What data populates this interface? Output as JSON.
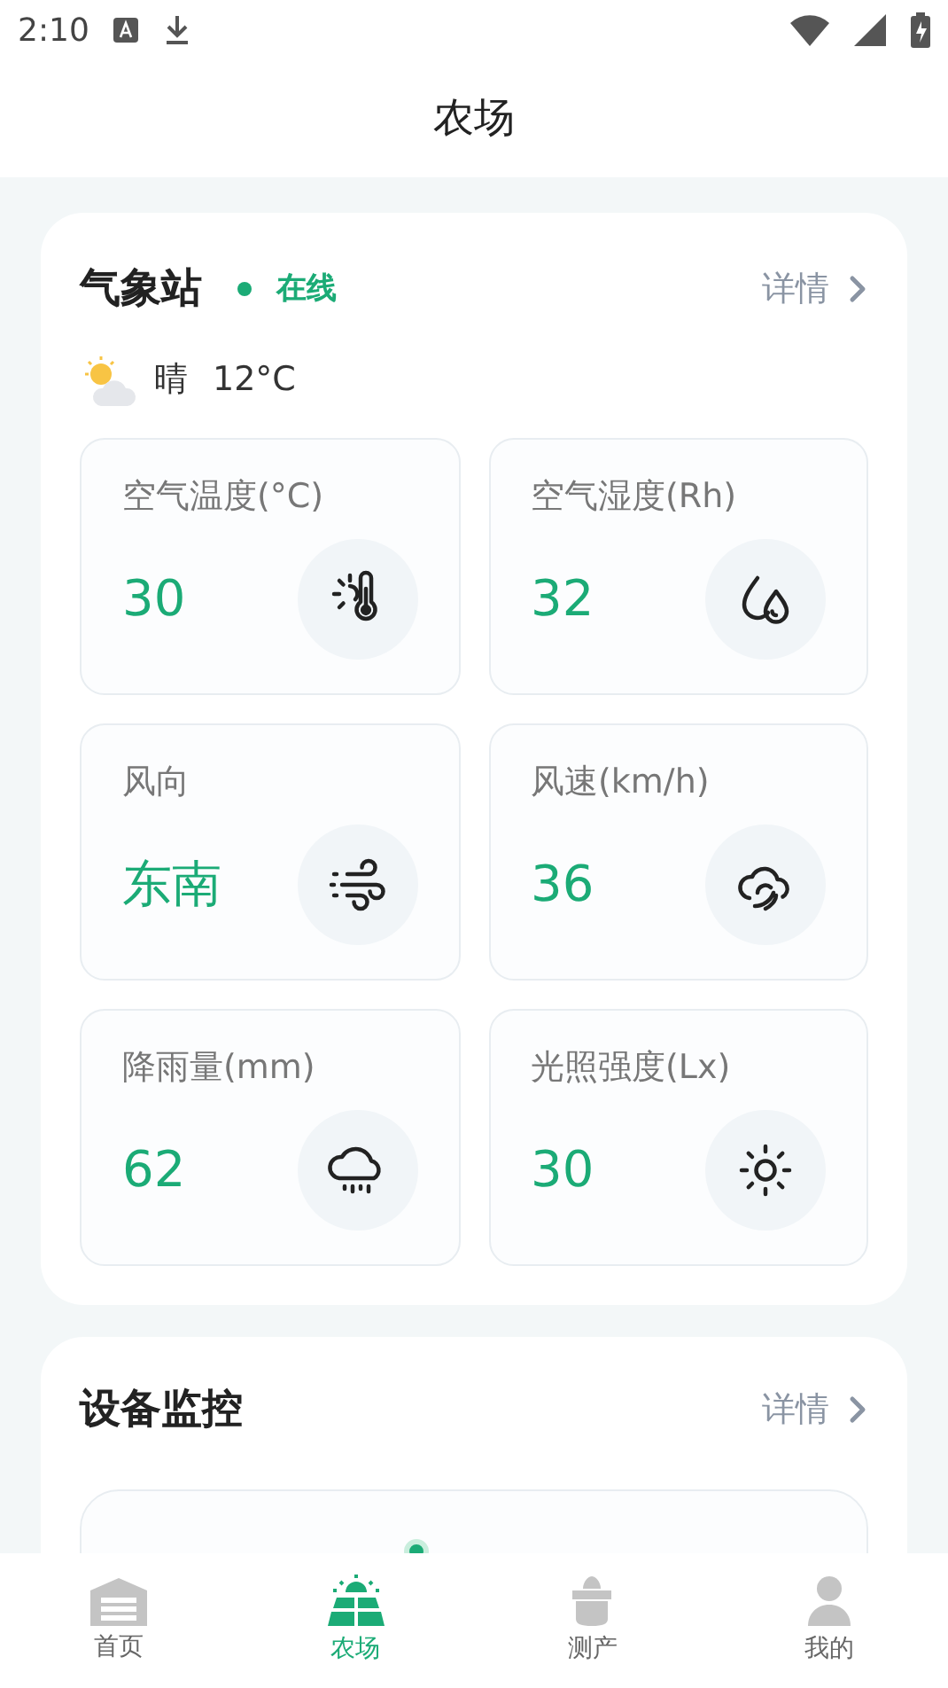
{
  "status_bar": {
    "time": "2:10"
  },
  "header": {
    "title": "农场"
  },
  "weather_station": {
    "title": "气象站",
    "online": true,
    "status": "在线",
    "details": "详情",
    "weather": "晴",
    "temperature": "12°C",
    "tiles": [
      {
        "kind": "temperature",
        "label": "空气温度(°C)",
        "value": "30"
      },
      {
        "kind": "humidity",
        "label": "空气湿度(Rh)",
        "value": "32"
      },
      {
        "kind": "wind_direction",
        "label": "风向",
        "value": "东南"
      },
      {
        "kind": "wind_speed",
        "label": "风速(km/h)",
        "value": "36"
      },
      {
        "kind": "rain",
        "label": "降雨量(mm)",
        "value": "62"
      },
      {
        "kind": "light",
        "label": "光照强度(Lx)",
        "value": "30"
      }
    ]
  },
  "device_monitor": {
    "title": "设备监控",
    "details": "详情"
  },
  "tabs": [
    {
      "kind": "home",
      "label": "首页",
      "selected": false
    },
    {
      "kind": "farm",
      "label": "农场",
      "selected": true
    },
    {
      "kind": "yield",
      "label": "测产",
      "selected": false
    },
    {
      "kind": "me",
      "label": "我的",
      "selected": false
    }
  ]
}
